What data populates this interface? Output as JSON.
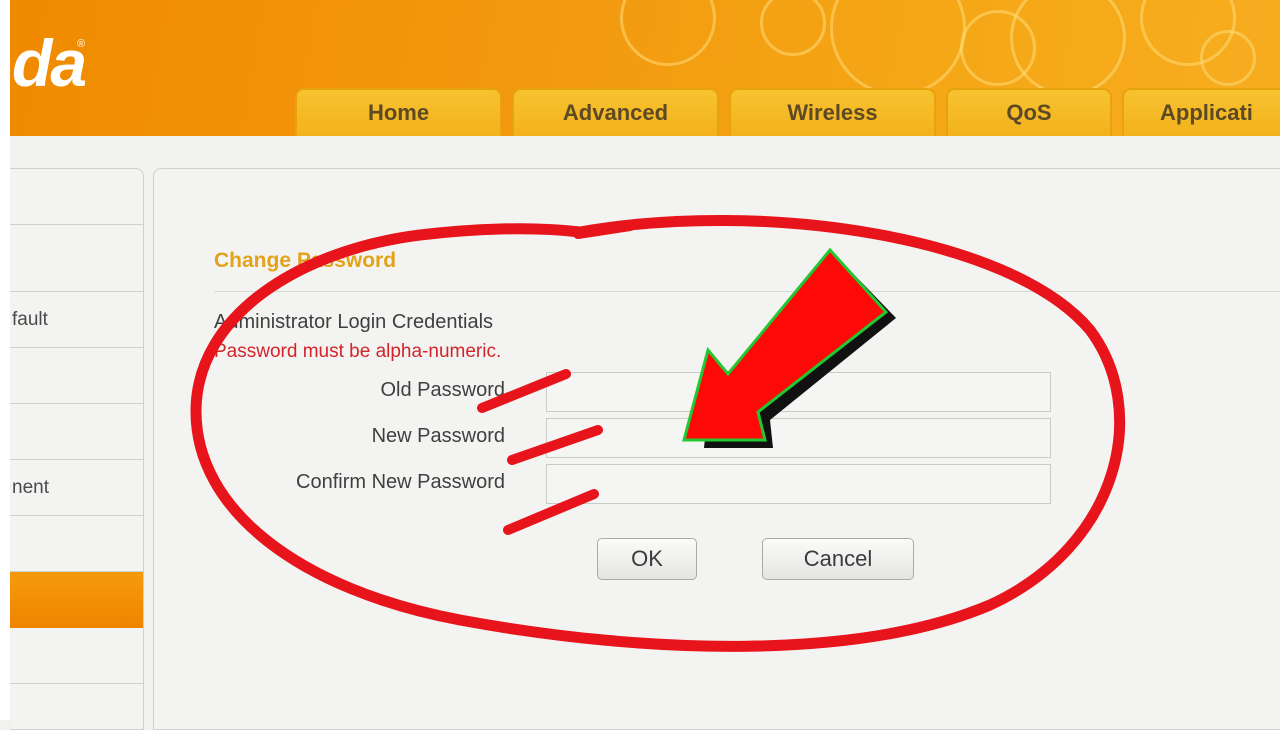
{
  "header": {
    "logo_text": "da",
    "logo_mark": "®",
    "tabs": [
      {
        "label": "Home"
      },
      {
        "label": "Advanced"
      },
      {
        "label": "Wireless"
      },
      {
        "label": "QoS"
      },
      {
        "label": "Applicati"
      }
    ]
  },
  "sidebar": {
    "items": [
      {
        "label": ""
      },
      {
        "label": ""
      },
      {
        "label": "fault"
      },
      {
        "label": ""
      },
      {
        "label": ""
      },
      {
        "label": "nent"
      },
      {
        "label": ""
      },
      {
        "label": "",
        "active": true
      },
      {
        "label": ""
      }
    ]
  },
  "main": {
    "section_title": "Change Password",
    "subtitle": "Administrator Login Credentials",
    "warning": "Password must be alpha-numeric.",
    "fields": [
      {
        "label": "Old Password",
        "value": ""
      },
      {
        "label": "New Password",
        "value": ""
      },
      {
        "label": "Confirm New Password",
        "value": ""
      }
    ],
    "ok_label": "OK",
    "cancel_label": "Cancel"
  },
  "colors": {
    "header_orange": "#f39a10",
    "tab_yellow": "#f5b924",
    "section_title": "#e3a21a",
    "warning_red": "#d2242a",
    "annotation_red": "#e8141c",
    "arrow_outline": "#22c832"
  },
  "annotations": {
    "circle": "red-ellipse-annotation",
    "arrow": "red-arrow-annotation"
  }
}
